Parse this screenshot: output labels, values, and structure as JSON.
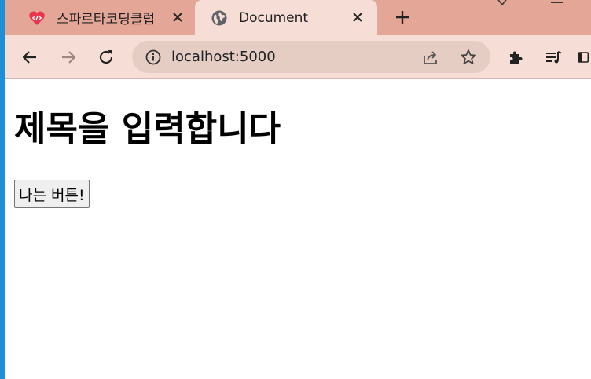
{
  "browser": {
    "tabs": [
      {
        "title": "스파르타코딩클럽",
        "icon": "code-heart-icon",
        "active": false
      },
      {
        "title": "Document",
        "icon": "globe-icon",
        "active": true
      }
    ],
    "address_bar": {
      "url": "localhost:5000"
    }
  },
  "page": {
    "heading": "제목을 입력합니다",
    "button_label": "나는 버튼!"
  },
  "colors": {
    "tabstrip": "#e4a797",
    "toolbar": "#f6ddd5",
    "omnibox": "#e5cdc4",
    "favicon_red": "#e8344e",
    "taskbar_stripe": "#1c8fd8"
  }
}
